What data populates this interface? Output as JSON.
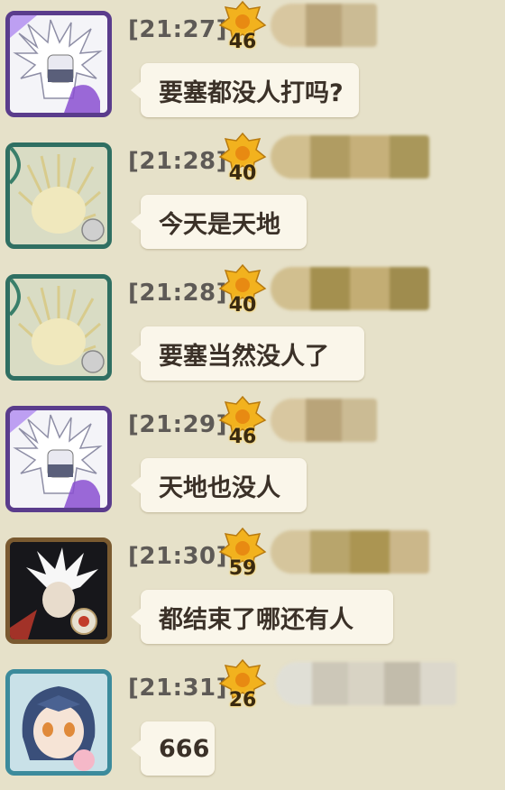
{
  "messages": [
    {
      "time": "[21:27]",
      "level": "46",
      "text": "要塞都没人打吗?",
      "avatar": "white-haired-ninja-purple-frame"
    },
    {
      "time": "[21:28]",
      "level": "40",
      "text": "今天是天地",
      "avatar": "blonde-spiky-hair-green-frame"
    },
    {
      "time": "[21:28]",
      "level": "40",
      "text": "要塞当然没人了",
      "avatar": "blonde-spiky-hair-green-frame"
    },
    {
      "time": "[21:29]",
      "level": "46",
      "text": "天地也没人",
      "avatar": "white-haired-ninja-purple-frame"
    },
    {
      "time": "[21:30]",
      "level": "59",
      "text": "都结束了哪还有人",
      "avatar": "white-spiky-hair-dark-frame"
    },
    {
      "time": "[21:31]",
      "level": "26",
      "text": "666",
      "avatar": "blue-haired-girl-teal-frame"
    }
  ],
  "colors": {
    "background": "#e6e1c9",
    "bubble": "#faf6ea",
    "timestamp": "#5e5a56",
    "badge": "#f2b21e"
  }
}
